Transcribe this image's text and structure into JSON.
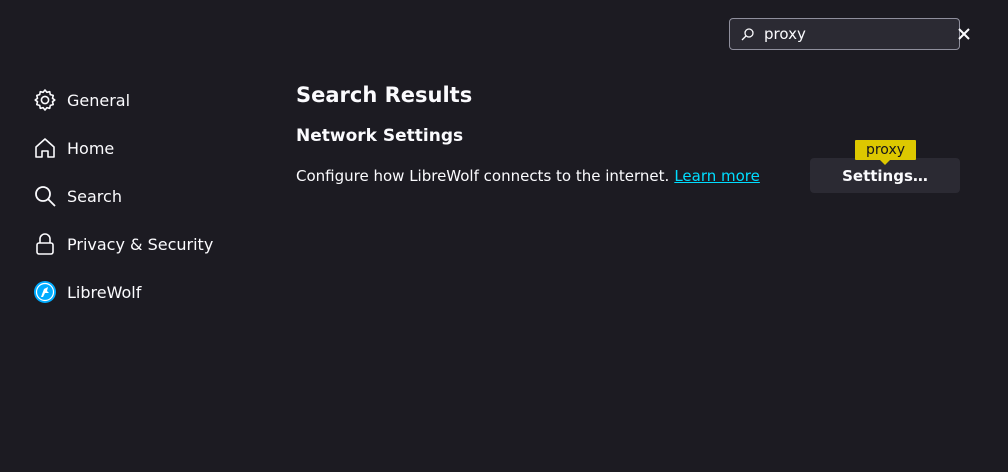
{
  "search": {
    "value": "proxy",
    "icon": "search-icon",
    "clear_icon": "close-icon"
  },
  "sidebar": {
    "items": [
      {
        "label": "General",
        "icon": "gear-icon"
      },
      {
        "label": "Home",
        "icon": "home-icon"
      },
      {
        "label": "Search",
        "icon": "search-icon"
      },
      {
        "label": "Privacy & Security",
        "icon": "lock-icon"
      },
      {
        "label": "LibreWolf",
        "icon": "librewolf-logo-icon"
      }
    ]
  },
  "main": {
    "title": "Search Results",
    "section_title": "Network Settings",
    "description": "Configure how LibreWolf connects to the internet.",
    "learn_more": "Learn more",
    "settings_button": "Settings…",
    "highlight_tooltip": "proxy"
  },
  "colors": {
    "background": "#1c1b22",
    "link": "#00ddff",
    "tooltip": "#ddc800",
    "button": "#2b2a33"
  }
}
